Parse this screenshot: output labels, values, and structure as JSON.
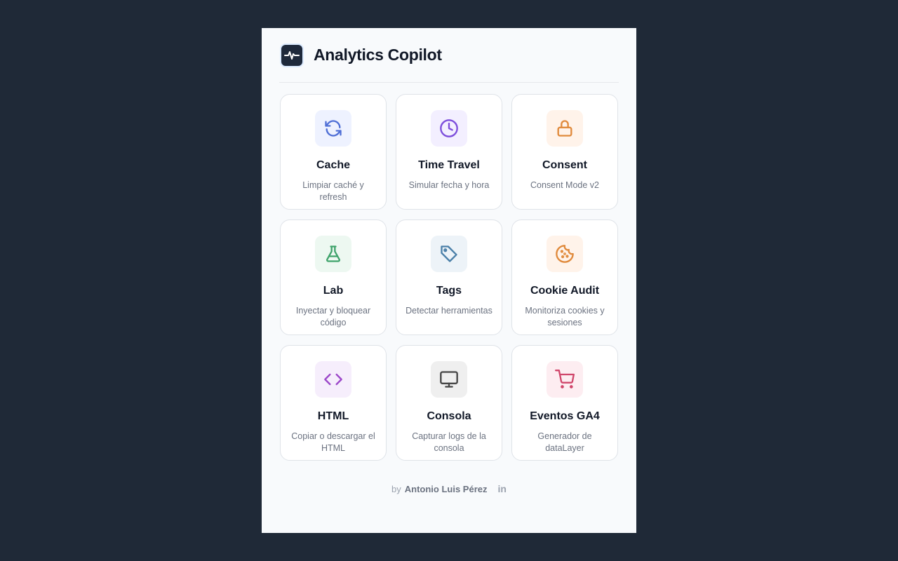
{
  "header": {
    "title": "Analytics Copilot",
    "logo_icon": "activity-pulse-icon"
  },
  "cards": [
    {
      "title": "Cache",
      "desc": "Limpiar caché y refresh",
      "icon": "refresh-icon",
      "bg": "#eef2ff",
      "color": "#4f6fd6"
    },
    {
      "title": "Time Travel",
      "desc": "Simular fecha y hora",
      "icon": "clock-icon",
      "bg": "#f3efff",
      "color": "#7c4ddb"
    },
    {
      "title": "Consent",
      "desc": "Consent Mode v2",
      "icon": "lock-icon",
      "bg": "#fff3ea",
      "color": "#e08a3c"
    },
    {
      "title": "Lab",
      "desc": "Inyectar y bloquear código",
      "icon": "flask-icon",
      "bg": "#edf8f1",
      "color": "#3fa36b"
    },
    {
      "title": "Tags",
      "desc": "Detectar herramientas",
      "icon": "tag-icon",
      "bg": "#edf3f8",
      "color": "#4a7fa8"
    },
    {
      "title": "Cookie Audit",
      "desc": "Monitoriza cookies y sesiones",
      "icon": "cookie-icon",
      "bg": "#fff3ea",
      "color": "#e08a3c"
    },
    {
      "title": "HTML",
      "desc": "Copiar o descargar el HTML",
      "icon": "code-icon",
      "bg": "#f6eefc",
      "color": "#9c47c9"
    },
    {
      "title": "Consola",
      "desc": "Capturar logs de la consola",
      "icon": "monitor-icon",
      "bg": "#efefef",
      "color": "#444444"
    },
    {
      "title": "Eventos GA4",
      "desc": "Generador de dataLayer",
      "icon": "cart-icon",
      "bg": "#fdedf1",
      "color": "#d0466b"
    }
  ],
  "footer": {
    "by": "by",
    "author": "Antonio Luis Pérez",
    "linkedin": "in"
  }
}
